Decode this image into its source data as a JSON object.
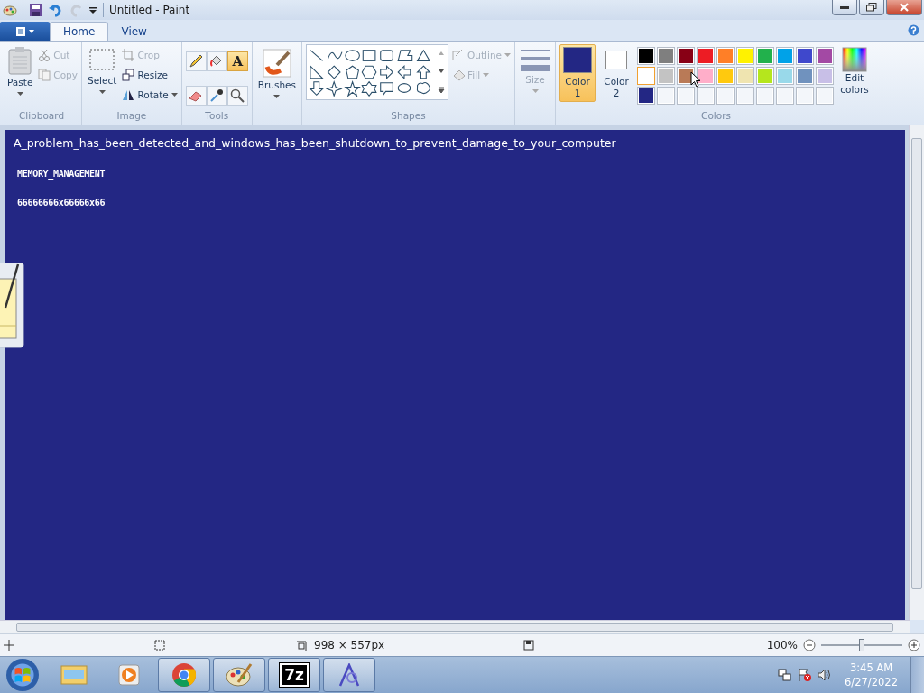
{
  "window": {
    "title": "Untitled - Paint"
  },
  "tabs": [
    {
      "label": "Home",
      "selected": true
    },
    {
      "label": "View",
      "selected": false
    }
  ],
  "clipboard": {
    "label": "Clipboard",
    "paste": "Paste",
    "cut": {
      "label": "Cut",
      "disabled": true
    },
    "copy": {
      "label": "Copy",
      "disabled": true
    }
  },
  "image": {
    "label": "Image",
    "select": "Select",
    "crop": {
      "label": "Crop",
      "disabled": true
    },
    "resize": {
      "label": "Resize",
      "disabled": false
    },
    "rotate": {
      "label": "Rotate",
      "disabled": false
    }
  },
  "tools": {
    "label": "Tools",
    "items": [
      {
        "kind": "pencil",
        "selected": false
      },
      {
        "kind": "fill",
        "selected": false
      },
      {
        "kind": "text",
        "selected": true,
        "glyph": "A"
      },
      {
        "kind": "eraser",
        "selected": false
      },
      {
        "kind": "picker",
        "selected": false
      },
      {
        "kind": "magnifier",
        "selected": false
      }
    ]
  },
  "brushes": {
    "label": "Brushes"
  },
  "shapes": {
    "label": "Shapes",
    "outline": {
      "label": "Outline",
      "disabled": true
    },
    "fill": {
      "label": "Fill",
      "disabled": true
    }
  },
  "size": {
    "label": "Size",
    "disabled": true
  },
  "colors": {
    "label": "Colors",
    "color1": {
      "label": "Color 1",
      "color": "#232784",
      "selected": true
    },
    "color2": {
      "label": "Color 2",
      "color": "#ffffff",
      "selected": false
    },
    "palette": [
      {
        "color": "#000000",
        "selected": false
      },
      {
        "color": "#7f7f7f",
        "selected": false
      },
      {
        "color": "#880015",
        "selected": false
      },
      {
        "color": "#ed1c24",
        "selected": false
      },
      {
        "color": "#ff7f27",
        "selected": false
      },
      {
        "color": "#fff200",
        "selected": false
      },
      {
        "color": "#22b14c",
        "selected": false
      },
      {
        "color": "#00a2e8",
        "selected": false
      },
      {
        "color": "#3f48cc",
        "selected": false
      },
      {
        "color": "#a349a4",
        "selected": false
      },
      {
        "color": "#ffffff",
        "selected": true
      },
      {
        "color": "#c3c3c3",
        "selected": false
      },
      {
        "color": "#b97a57",
        "selected": false
      },
      {
        "color": "#ffaec9",
        "selected": false
      },
      {
        "color": "#ffc90e",
        "selected": false
      },
      {
        "color": "#efe4b0",
        "selected": false
      },
      {
        "color": "#b5e61d",
        "selected": false
      },
      {
        "color": "#99d9ea",
        "selected": false
      },
      {
        "color": "#7092be",
        "selected": false
      },
      {
        "color": "#c8bfe7",
        "selected": false
      },
      {
        "color": "#232784",
        "selected": false
      }
    ],
    "edit": "Edit colors"
  },
  "canvas": {
    "color": "#232784",
    "lines": [
      {
        "kind": "sans",
        "text": "A_problem_has_been_detected_and_windows_has_been_shutdown_to_prevent_damage_to_your_computer"
      },
      {
        "kind": "pixel",
        "text": "MEMORY_MANAGEMENT"
      },
      {
        "kind": "pixel",
        "text": "66666666x66666x66"
      }
    ]
  },
  "status_bar": {
    "dimensions": "998 × 557px",
    "zoom": "100%",
    "zoom_slider": {
      "level": 0.5
    }
  },
  "taskbar": {
    "apps": [
      {
        "kind": "folder",
        "selected": false
      },
      {
        "kind": "media",
        "selected": false
      },
      {
        "kind": "chrome",
        "selected": true
      },
      {
        "kind": "paint",
        "selected": true
      },
      {
        "kind": "sevenzip",
        "selected": true,
        "text": "7z"
      },
      {
        "kind": "font",
        "selected": true
      }
    ],
    "time": "3:45 AM",
    "date": "6/27/2022"
  }
}
